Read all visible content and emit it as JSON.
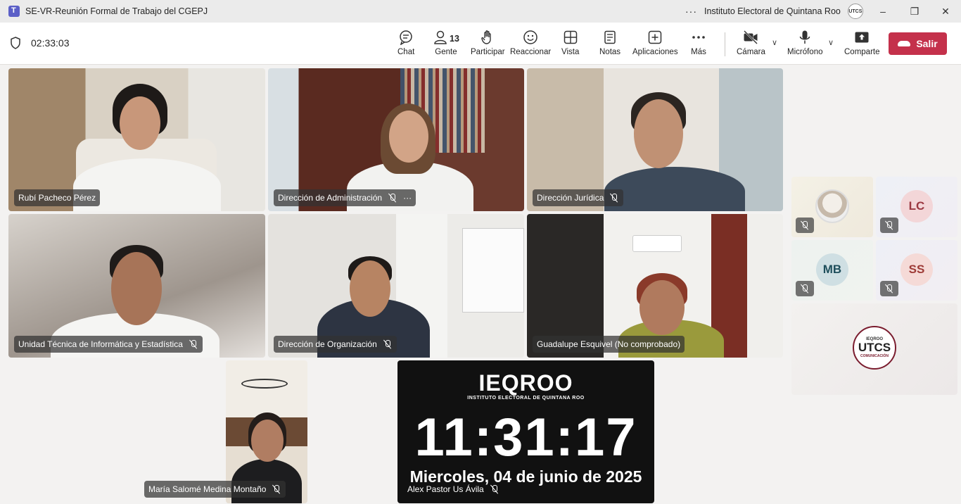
{
  "window": {
    "title": "SE-VR-Reunión Formal de Trabajo del CGEPJ",
    "organization": "Instituto Electoral de Quintana Roo",
    "org_badge": "UTCS"
  },
  "toolbar": {
    "timer": "02:33:03",
    "chat": "Chat",
    "people": "Gente",
    "people_count": "13",
    "raise": "Participar",
    "react": "Reaccionar",
    "view": "Vista",
    "notes": "Notas",
    "apps": "Aplicaciones",
    "more": "Más",
    "camera": "Cámara",
    "mic": "Micrófono",
    "share": "Comparte",
    "leave": "Salir"
  },
  "participants": [
    {
      "name": "Rubí Pacheco Pérez"
    },
    {
      "name": "Dirección de Administración"
    },
    {
      "name": "Dirección Jurídica"
    },
    {
      "name": "Unidad Técnica de Informática y Estadística"
    },
    {
      "name": "Dirección de Organización"
    },
    {
      "name": "Guadalupe Esquivel (No comprobado)"
    },
    {
      "name": "María Salomé Medina Montaño"
    },
    {
      "name": "Alex Pastor Us Ávila"
    }
  ],
  "side_tiles": [
    {
      "initials": ""
    },
    {
      "initials": "LC"
    },
    {
      "initials": "MB"
    },
    {
      "initials": "SS"
    }
  ],
  "utcs_logo": {
    "top": "IEQROO",
    "main": "UTCS",
    "sub": "COMUNICACIÓN"
  },
  "clock": {
    "logo": "IEQROO",
    "logo_sub": "INSTITUTO ELECTORAL DE QUINTANA ROO",
    "time": "11:31:17",
    "date": "Miercoles, 04 de junio de 2025"
  }
}
